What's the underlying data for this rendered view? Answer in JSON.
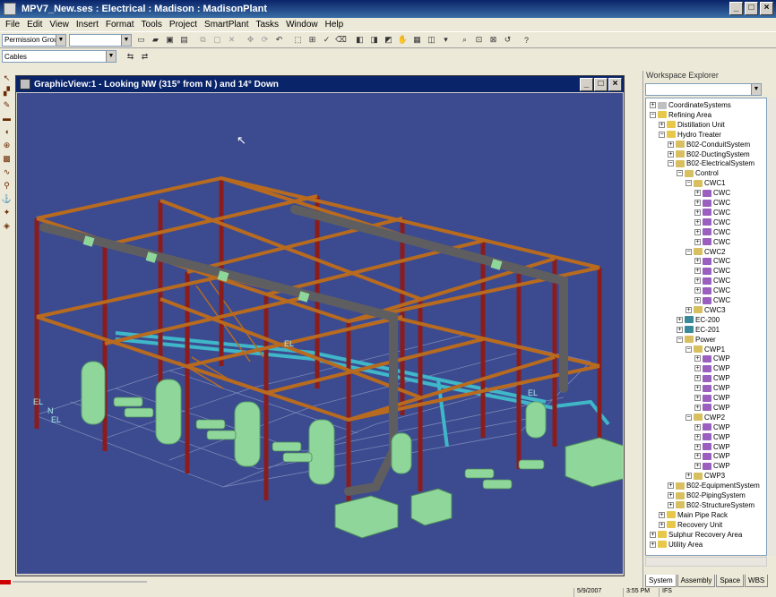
{
  "window": {
    "title": "MPV7_New.ses : Electrical : Madison : MadisonPlant"
  },
  "menu": [
    "File",
    "Edit",
    "View",
    "Insert",
    "Format",
    "Tools",
    "Project",
    "SmartPlant",
    "Tasks",
    "Window",
    "Help"
  ],
  "toolbar": {
    "permission_group": "Permission Group",
    "filter_value": "",
    "cables_combo": "Cables"
  },
  "graphic_view": {
    "title": "GraphicView:1 - Looking NW (315° from N ) and 14° Down",
    "labels": [
      "EL",
      "EL",
      "N",
      "EL",
      "EL"
    ]
  },
  "workspace": {
    "title": "Workspace Explorer",
    "combo_value": "",
    "tabs": [
      "System",
      "Assembly",
      "Space",
      "WBS"
    ],
    "tree": [
      {
        "label": "CoordinateSystems",
        "level": 1,
        "icon": "coord"
      },
      {
        "label": "Refining Area",
        "level": 1,
        "icon": "folder"
      },
      {
        "label": "Distillation Unit",
        "level": 2,
        "icon": "folder"
      },
      {
        "label": "Hydro Treater",
        "level": 2,
        "icon": "folder"
      },
      {
        "label": "B02-ConduitSystem",
        "level": 3,
        "icon": "sys"
      },
      {
        "label": "B02-DuctingSystem",
        "level": 3,
        "icon": "sys"
      },
      {
        "label": "B02-ElectricalSystem",
        "level": 3,
        "icon": "sys"
      },
      {
        "label": "Control",
        "level": 4,
        "icon": "sys"
      },
      {
        "label": "CWC1",
        "level": 5,
        "icon": "sys"
      },
      {
        "label": "CWC",
        "level": 6,
        "icon": "cable"
      },
      {
        "label": "CWC",
        "level": 6,
        "icon": "cable"
      },
      {
        "label": "CWC",
        "level": 6,
        "icon": "cable"
      },
      {
        "label": "CWC",
        "level": 6,
        "icon": "cable"
      },
      {
        "label": "CWC",
        "level": 6,
        "icon": "cable"
      },
      {
        "label": "CWC",
        "level": 6,
        "icon": "cable"
      },
      {
        "label": "CWC2",
        "level": 5,
        "icon": "sys"
      },
      {
        "label": "CWC",
        "level": 6,
        "icon": "cable"
      },
      {
        "label": "CWC",
        "level": 6,
        "icon": "cable"
      },
      {
        "label": "CWC",
        "level": 6,
        "icon": "cable"
      },
      {
        "label": "CWC",
        "level": 6,
        "icon": "cable"
      },
      {
        "label": "CWC",
        "level": 6,
        "icon": "cable"
      },
      {
        "label": "CWC3",
        "level": 5,
        "icon": "sys"
      },
      {
        "label": "EC-200",
        "level": 4,
        "icon": "equip"
      },
      {
        "label": "EC-201",
        "level": 4,
        "icon": "equip"
      },
      {
        "label": "Power",
        "level": 4,
        "icon": "sys"
      },
      {
        "label": "CWP1",
        "level": 5,
        "icon": "sys"
      },
      {
        "label": "CWP",
        "level": 6,
        "icon": "cable"
      },
      {
        "label": "CWP",
        "level": 6,
        "icon": "cable"
      },
      {
        "label": "CWP",
        "level": 6,
        "icon": "cable"
      },
      {
        "label": "CWP",
        "level": 6,
        "icon": "cable"
      },
      {
        "label": "CWP",
        "level": 6,
        "icon": "cable"
      },
      {
        "label": "CWP",
        "level": 6,
        "icon": "cable"
      },
      {
        "label": "CWP2",
        "level": 5,
        "icon": "sys"
      },
      {
        "label": "CWP",
        "level": 6,
        "icon": "cable"
      },
      {
        "label": "CWP",
        "level": 6,
        "icon": "cable"
      },
      {
        "label": "CWP",
        "level": 6,
        "icon": "cable"
      },
      {
        "label": "CWP",
        "level": 6,
        "icon": "cable"
      },
      {
        "label": "CWP",
        "level": 6,
        "icon": "cable"
      },
      {
        "label": "CWP3",
        "level": 5,
        "icon": "sys"
      },
      {
        "label": "B02-EquipmentSystem",
        "level": 3,
        "icon": "sys"
      },
      {
        "label": "B02-PipingSystem",
        "level": 3,
        "icon": "sys"
      },
      {
        "label": "B02-StructureSystem",
        "level": 3,
        "icon": "sys"
      },
      {
        "label": "Main Pipe Rack",
        "level": 2,
        "icon": "folder"
      },
      {
        "label": "Recovery Unit",
        "level": 2,
        "icon": "folder"
      },
      {
        "label": "Sulphur Recovery Area",
        "level": 1,
        "icon": "folder"
      },
      {
        "label": "Utility Area",
        "level": 1,
        "icon": "folder"
      }
    ]
  },
  "status": {
    "date": "5/9/2007",
    "time": "3:55 PM",
    "units": "IFS"
  },
  "colors": {
    "background": "#3c4b8f",
    "column": "#8b1c1c",
    "beam": "#b86b1f",
    "equipment": "#8fd69a",
    "pipe": "#6b6b6b",
    "cable_tray": "#3fb7c9"
  }
}
